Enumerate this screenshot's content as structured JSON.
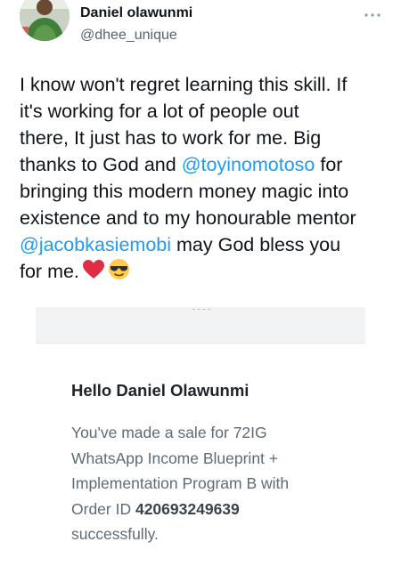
{
  "tweet": {
    "author": {
      "display_name": "Daniel olawunmi",
      "handle": "@dhee_unique",
      "avatar_icon": "avatar-photo"
    },
    "more_icon": "more-horizontal-icon",
    "text_lines": [
      {
        "text": "I know won't regret learning this skill. If"
      },
      {
        "text": "it's working for a lot of people out"
      },
      {
        "text": "there, It just has to work for me. Big"
      },
      {
        "pre": "thanks to God and ",
        "mention": "@toyinomotoso",
        "post": " for"
      },
      {
        "text": "bringing this modern money magic into"
      },
      {
        "text": "existence and to my honourable mentor"
      },
      {
        "mention": "@jacobkasiemobi",
        "post": " may God bless you"
      },
      {
        "pre": "for me."
      }
    ],
    "emojis": [
      "red-heart-emoji",
      "smiling-face-with-sunglasses-emoji"
    ],
    "colors": {
      "mention": "#1d9bf0",
      "text": "#0f1419",
      "handle": "#536471"
    }
  },
  "attached_image": {
    "greeting": "Hello Daniel Olawunmi",
    "body_lines": [
      {
        "text": "You've made a sale for 72IG"
      },
      {
        "text": "WhatsApp Income Blueprint +"
      },
      {
        "text": "Implementation Program B with"
      },
      {
        "pre": "Order ID ",
        "bold": "420693249639"
      },
      {
        "text": "successfully."
      }
    ]
  }
}
